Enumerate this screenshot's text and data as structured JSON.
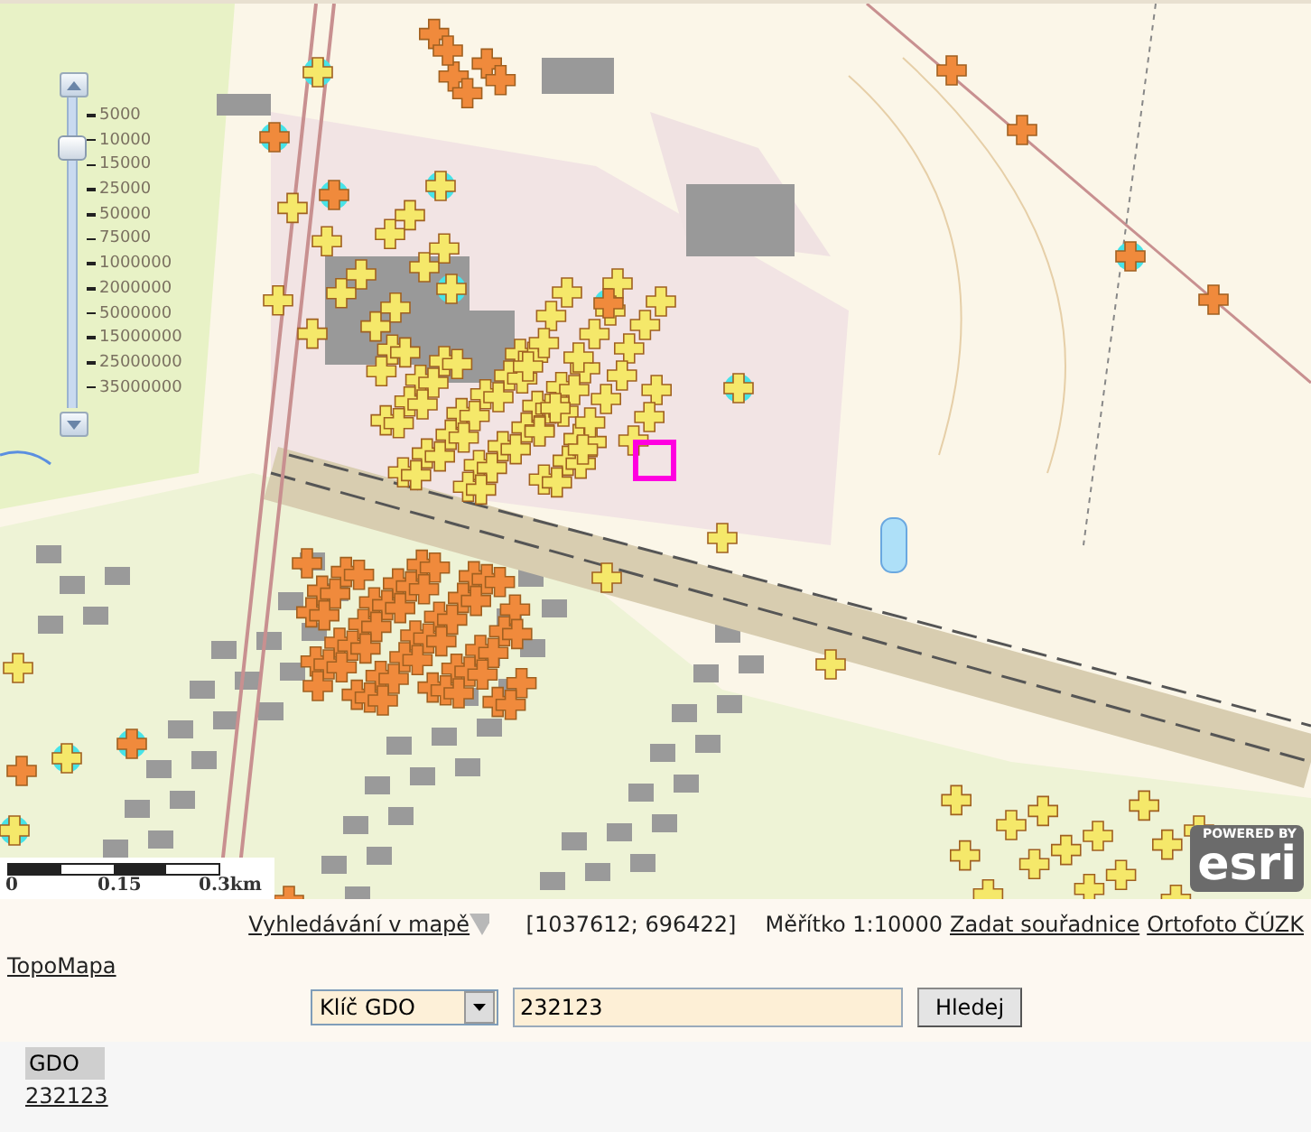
{
  "map": {
    "zoom_slider": {
      "level": 0.87,
      "scales": [
        "5000",
        "10000",
        "15000",
        "25000",
        "50000",
        "75000",
        "1000000",
        "2000000",
        "5000000",
        "15000000",
        "25000000",
        "35000000"
      ]
    },
    "scale_bar": [
      "0",
      "0.15",
      "0.3km"
    ],
    "logo": {
      "caption": "POWERED BY",
      "name": "esri"
    }
  },
  "toolbar": {
    "search_link": "Vyhledávání v mapě",
    "coordinates": "[1037612; 696422]",
    "scale": "Měřítko 1:10000",
    "links": [
      "Zadat souřadnice",
      "Ortofoto ČÚZK"
    ],
    "second_line_link": "TopoMapa"
  },
  "search": {
    "key": "Klíč GDO",
    "value": "232123",
    "button": "Hledej"
  },
  "results": {
    "column": "GDO",
    "rows": [
      "232123"
    ]
  }
}
